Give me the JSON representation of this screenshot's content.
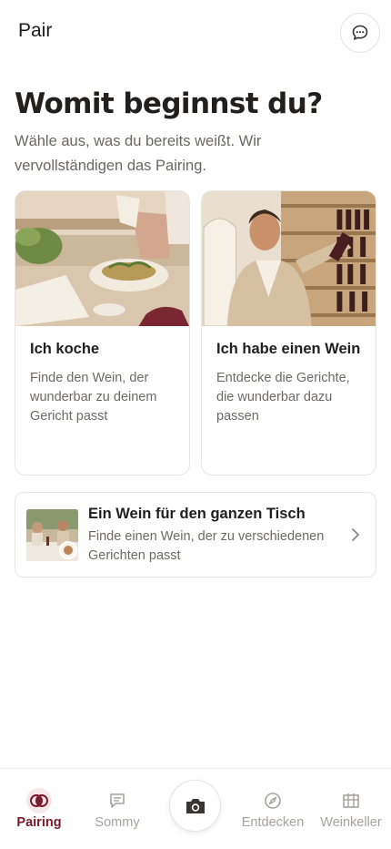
{
  "header": {
    "title": "Pair",
    "chat_icon": "chat-bubble-icon"
  },
  "intro": {
    "heading": "Womit beginnst du?",
    "subtitle": "Wähle aus, was du bereits weißt. Wir vervollständigen das Pairing."
  },
  "options": [
    {
      "title": "Ich koche",
      "description": "Finde den Wein, der wunderbar zu deinem Gericht passt"
    },
    {
      "title": "Ich habe einen Wein",
      "description": "Entdecke die Gerichte, die wunderbar dazu passen"
    }
  ],
  "table_option": {
    "title": "Ein Wein für den ganzen Tisch",
    "description": "Finde einen Wein, der zu verschiedenen Gerichten passt"
  },
  "bottom_nav": {
    "items": [
      {
        "label": "Pairing",
        "icon": "pairing-rings-icon",
        "active": true
      },
      {
        "label": "Sommy",
        "icon": "chat-icon",
        "active": false
      },
      {
        "label": "Entdecken",
        "icon": "compass-icon",
        "active": false
      },
      {
        "label": "Weinkeller",
        "icon": "wine-cellar-icon",
        "active": false
      }
    ],
    "camera_icon": "camera-icon"
  },
  "colors": {
    "accent": "#7b1a2c",
    "inactive": "#a8a29c",
    "border": "#e8e6e3"
  }
}
